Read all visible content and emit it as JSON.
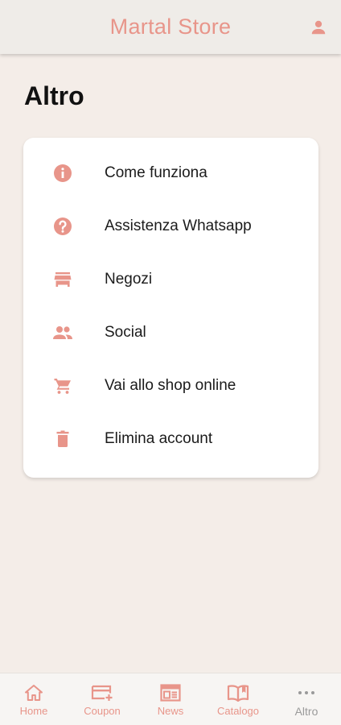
{
  "header": {
    "title": "Martal Store",
    "user_icon": "user-icon"
  },
  "page": {
    "title": "Altro"
  },
  "menu": {
    "items": [
      {
        "label": "Come funziona",
        "icon": "info-icon"
      },
      {
        "label": "Assistenza Whatsapp",
        "icon": "help-icon"
      },
      {
        "label": "Negozi",
        "icon": "store-icon"
      },
      {
        "label": "Social",
        "icon": "people-icon"
      },
      {
        "label": "Vai allo shop online",
        "icon": "cart-icon"
      },
      {
        "label": "Elimina account",
        "icon": "trash-icon"
      }
    ]
  },
  "bottom_nav": {
    "items": [
      {
        "label": "Home",
        "icon": "home-icon"
      },
      {
        "label": "Coupon",
        "icon": "coupon-icon"
      },
      {
        "label": "News",
        "icon": "news-icon"
      },
      {
        "label": "Catalogo",
        "icon": "book-icon"
      },
      {
        "label": "Altro",
        "icon": "more-dots-icon",
        "active": true
      }
    ]
  },
  "colors": {
    "accent": "#e8958a",
    "background": "#f4ede8",
    "inactive": "#9a9a9a"
  }
}
